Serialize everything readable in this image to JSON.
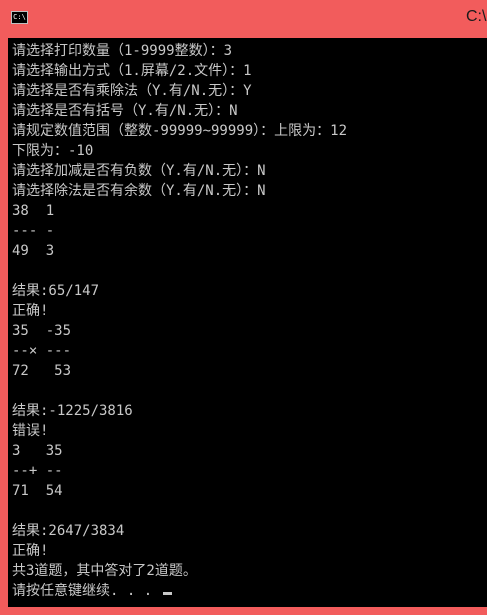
{
  "window": {
    "title": "C:\\",
    "icon_label": "C:\\"
  },
  "console": {
    "lines": [
      "请选择打印数量（1-9999整数）：3",
      "请选择输出方式（1.屏幕/2.文件）：1",
      "请选择是否有乘除法（Y.有/N.无）：Y",
      "请选择是否有括号（Y.有/N.无）：N",
      "请规定数值范围（整数-99999~99999）：上限为：12",
      "下限为：-10",
      "请选择加减是否有负数（Y.有/N.无）：N",
      "请选择除法是否有余数（Y.有/N.无）：N",
      "38  1",
      "--- -",
      "49  3",
      "",
      "结果:65/147",
      "正确!",
      "35  -35",
      "--× ---",
      "72   53",
      "",
      "结果:-1225/3816",
      "错误!",
      "3   35",
      "--+ --",
      "71  54",
      "",
      "结果:2647/3834",
      "正确!",
      "共3道题，其中答对了2道题。",
      "请按任意键继续. . . "
    ]
  }
}
